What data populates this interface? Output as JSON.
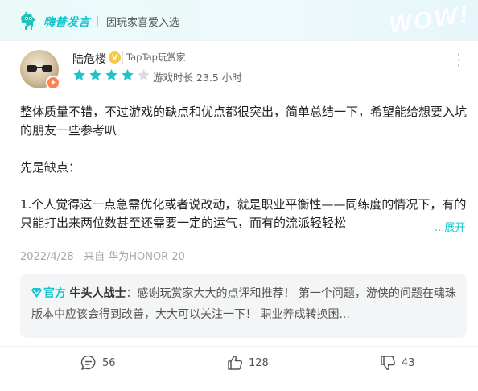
{
  "banner": {
    "brand": "嗨普发言",
    "subtitle": "因玩家喜爱入选",
    "decor_text": "WOW!"
  },
  "review": {
    "username": "陆危楼",
    "verified_badge": "V",
    "user_tag": "TapTap玩赏家",
    "rating": 4,
    "rating_max": 5,
    "star_color": "#1ec4cc",
    "star_empty_color": "#d9dde0",
    "playtime": "游戏时长 23.5 小时",
    "paragraphs": [
      "整体质量不错，不过游戏的缺点和优点都很突出，简单总结一下，希望能给想要入坑的朋友一些参考叭",
      "先是缺点：",
      "1.个人觉得这一点急需优化或者说改动，就是职业平衡性——同练度的情况下，有的只能打出来两位数甚至还需要一定的运气，而有的流派轻轻松"
    ],
    "expand_label": "...展开",
    "date": "2022/4/28",
    "device": "来自 华为HONOR 20"
  },
  "official_reply": {
    "official_label": "官方",
    "author": "牛头人战士",
    "text": "：感谢玩赏家大大的点评和推荐！ 第一个问题，游侠的问题在魂珠版本中应该会得到改善，大大可以关注一下！ 职业养成转换困..."
  },
  "actions": {
    "comments": "56",
    "likes": "128",
    "dislikes": "43"
  },
  "colors": {
    "accent": "#15c5ce",
    "badge_orange": "#ff7f4d",
    "badge_gold": "#f7c842"
  }
}
